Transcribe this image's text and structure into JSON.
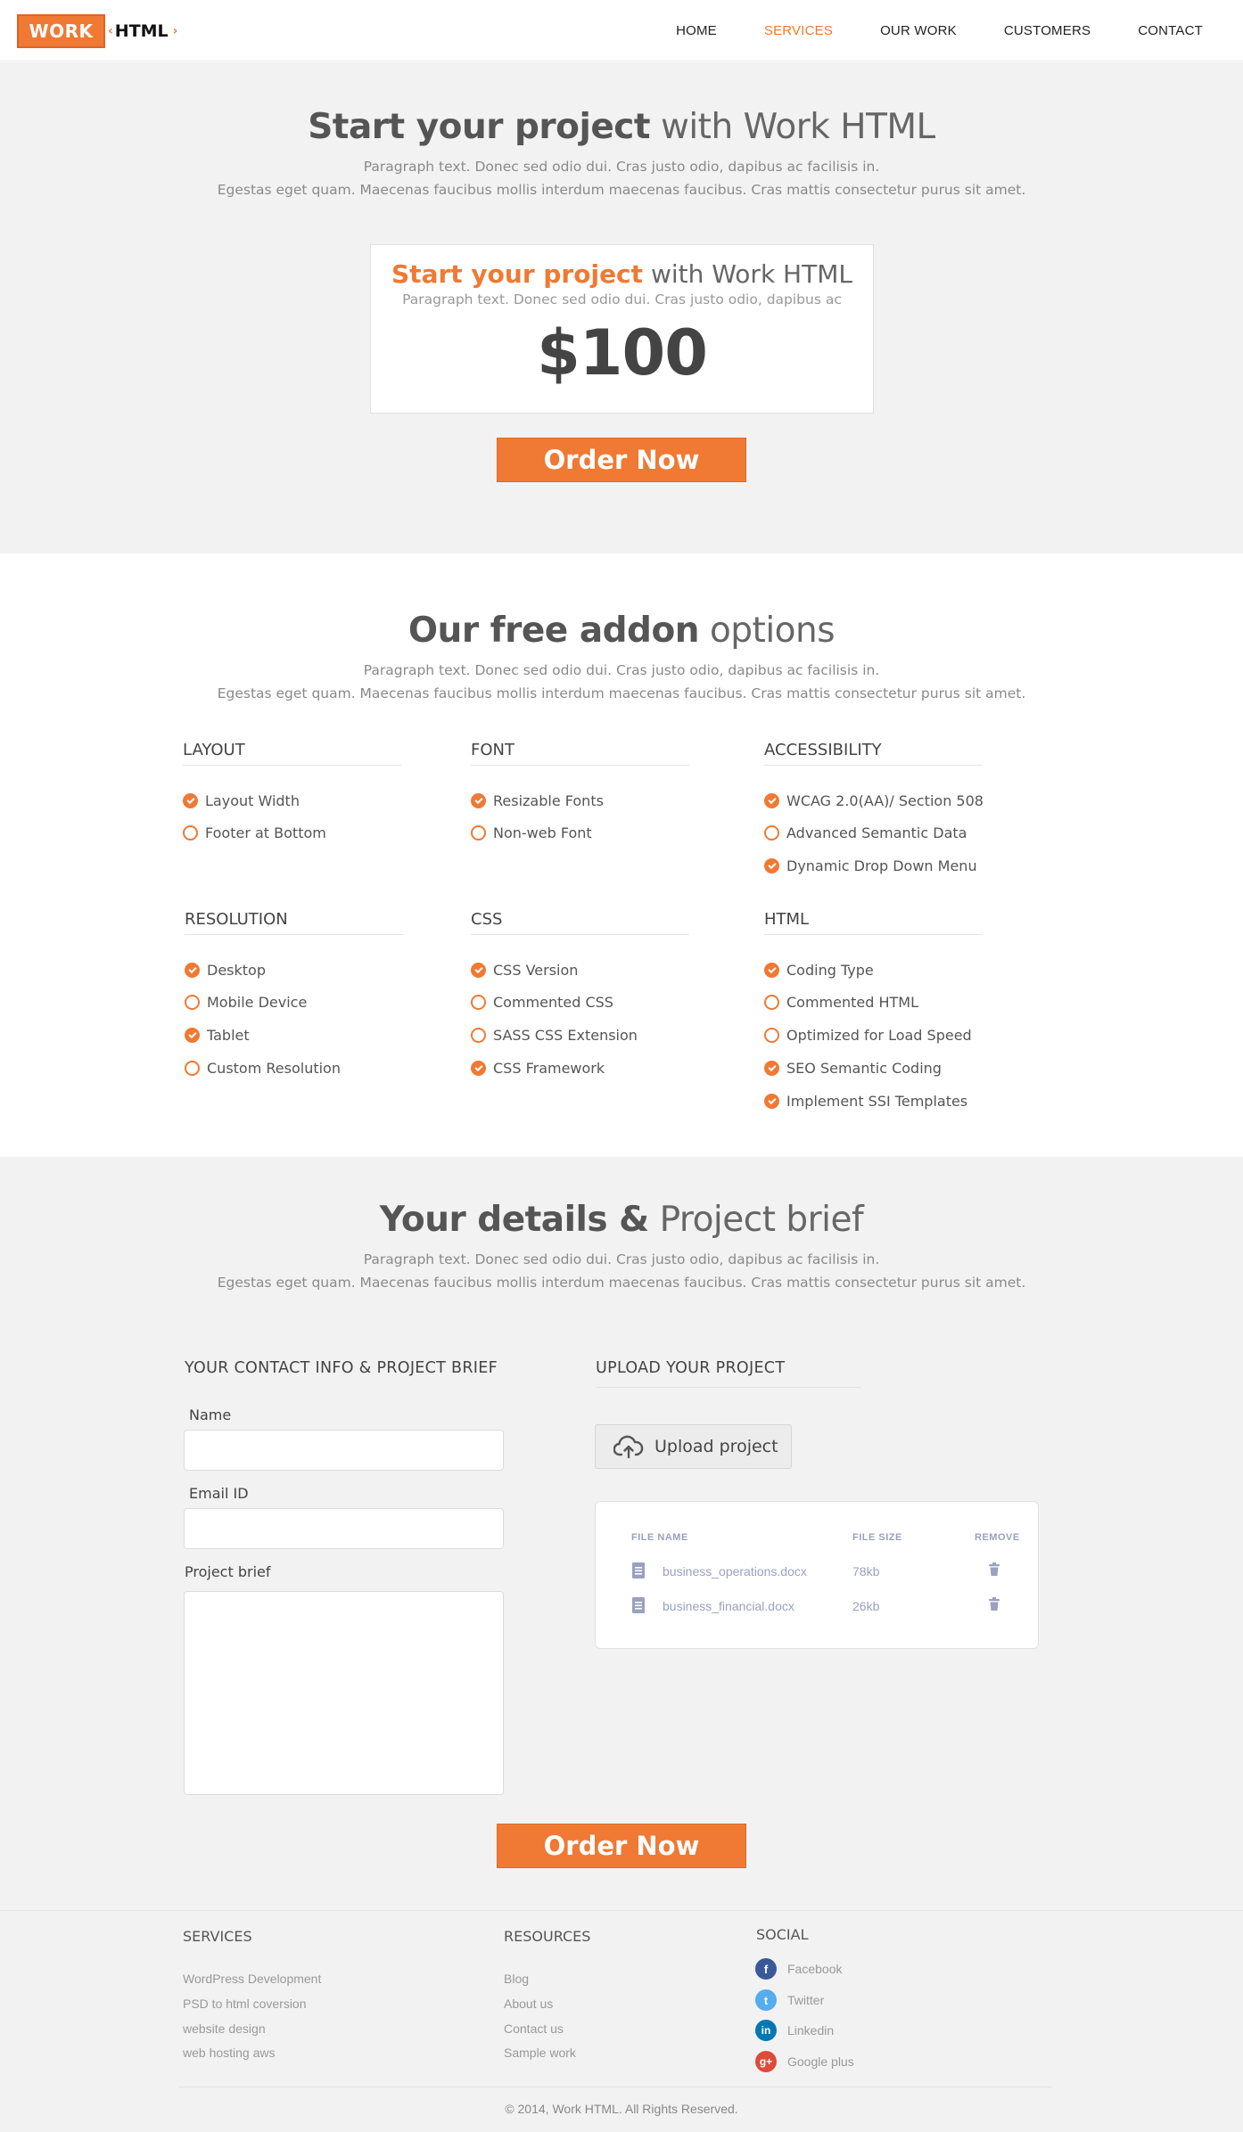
{
  "header": {
    "logo_work": "WORK",
    "logo_html": "HTML",
    "nav": [
      {
        "label": "HOME"
      },
      {
        "label": "SERVICES",
        "active": true
      },
      {
        "label": "OUR WORK"
      },
      {
        "label": "CUSTOMERS"
      },
      {
        "label": "CONTACT"
      }
    ]
  },
  "hero": {
    "title_bold": "Start your project",
    "title_light": "with Work HTML",
    "para_line1": "Paragraph text. Donec sed odio dui. Cras justo odio, dapibus ac facilisis in.",
    "para_line2": "Egestas eget quam. Maecenas faucibus mollis interdum maecenas faucibus. Cras mattis consectetur purus sit amet.",
    "card": {
      "title_bold": "Start your project",
      "title_light": "with Work HTML",
      "sub": "Paragraph text. Donec sed odio dui. Cras justo odio, dapibus ac",
      "price": "$100"
    },
    "order_label": "Order Now"
  },
  "addons": {
    "title_bold": "Our free addon",
    "title_light": "options",
    "para_line1": "Paragraph text. Donec sed odio dui. Cras justo odio, dapibus ac facilisis in.",
    "para_line2": "Egestas eget quam. Maecenas faucibus mollis interdum maecenas faucibus. Cras mattis consectetur purus sit amet.",
    "groups": [
      {
        "title": "LAYOUT",
        "options": [
          {
            "label": "Layout Width",
            "checked": true
          },
          {
            "label": "Footer at Bottom",
            "checked": false
          }
        ]
      },
      {
        "title": "FONT",
        "options": [
          {
            "label": "Resizable Fonts",
            "checked": true
          },
          {
            "label": "Non-web Font",
            "checked": false
          }
        ]
      },
      {
        "title": "ACCESSIBILITY",
        "options": [
          {
            "label": "WCAG 2.0(AA)/ Section 508",
            "checked": true
          },
          {
            "label": "Advanced Semantic Data",
            "checked": false
          },
          {
            "label": "Dynamic Drop Down Menu",
            "checked": true
          }
        ]
      },
      {
        "title": "RESOLUTION",
        "options": [
          {
            "label": "Desktop",
            "checked": true
          },
          {
            "label": "Mobile Device",
            "checked": false
          },
          {
            "label": "Tablet",
            "checked": true
          },
          {
            "label": "Custom Resolution",
            "checked": false
          }
        ]
      },
      {
        "title": "CSS",
        "options": [
          {
            "label": "CSS Version",
            "checked": true
          },
          {
            "label": "Commented CSS",
            "checked": false
          },
          {
            "label": "SASS CSS Extension",
            "checked": false
          },
          {
            "label": "CSS Framework",
            "checked": true
          }
        ]
      },
      {
        "title": "HTML",
        "options": [
          {
            "label": "Coding Type",
            "checked": true
          },
          {
            "label": "Commented HTML",
            "checked": false
          },
          {
            "label": "Optimized for Load Speed",
            "checked": false
          },
          {
            "label": "SEO Semantic Coding",
            "checked": true
          },
          {
            "label": "Implement SSI Templates",
            "checked": true
          }
        ]
      }
    ]
  },
  "details": {
    "title_bold": "Your details &",
    "title_light": "Project brief",
    "para_line1": "Paragraph text. Donec sed odio dui. Cras justo odio, dapibus ac facilisis in.",
    "para_line2": "Egestas eget quam. Maecenas faucibus mollis interdum maecenas faucibus. Cras mattis consectetur purus sit amet.",
    "contact_heading": "YOUR CONTACT INFO & PROJECT BRIEF",
    "name_label": "Name",
    "name_value": "",
    "email_label": "Email ID",
    "email_value": "",
    "brief_label": "Project brief",
    "brief_value": "",
    "upload_heading": "UPLOAD YOUR PROJECT",
    "upload_button": "Upload project",
    "file_table": {
      "headers": [
        "FILE NAME",
        "FILE SIZE",
        "REMOVE"
      ],
      "rows": [
        {
          "name": "business_operations.docx",
          "size": "78kb"
        },
        {
          "name": "business_financial.docx",
          "size": "26kb"
        }
      ]
    },
    "order_label": "Order Now"
  },
  "footer": {
    "services_heading": "SERVICES",
    "services": [
      "WordPress Development",
      "PSD to html coversion",
      "website design",
      "web hosting aws"
    ],
    "resources_heading": "RESOURCES",
    "resources": [
      "Blog",
      "About us",
      "Contact us",
      "Sample work"
    ],
    "social_heading": "SOCIAL",
    "social": [
      {
        "label": "Facebook",
        "icon": "facebook-icon",
        "color": "#3b5998"
      },
      {
        "label": "Twitter",
        "icon": "twitter-icon",
        "color": "#55acee"
      },
      {
        "label": "Linkedin",
        "icon": "linkedin-icon",
        "color": "#0077b5"
      },
      {
        "label": "Google plus",
        "icon": "google-plus-icon",
        "color": "#dd4b39"
      }
    ],
    "copyright": "© 2014, Work HTML. All Rights Reserved."
  },
  "colors": {
    "accent": "#f07933",
    "section_bg": "#f2f2f2",
    "file_text": "#9aa0c0"
  }
}
